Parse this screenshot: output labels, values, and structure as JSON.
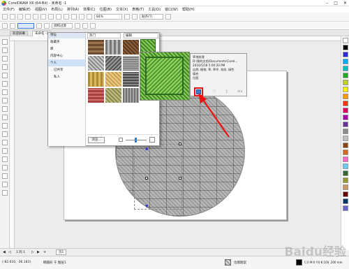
{
  "window": {
    "title": "CorelDRAW X6 (64-Bit) - 未命名 -1"
  },
  "menu": {
    "items": [
      "文件(F)",
      "编辑(E)",
      "视图(V)",
      "布局(L)",
      "排列(A)",
      "效果(C)",
      "位图(B)",
      "文本(X)",
      "表格(T)",
      "工具(O)",
      "窗口(W)",
      "帮助(H)"
    ]
  },
  "toolbar": {
    "zoom": "84%",
    "snap_label": "贴齐(T)",
    "snap2_label": "调和过渡"
  },
  "tabs": [
    "欢迎屏幕",
    "未命名 -1"
  ],
  "popup": {
    "folder_header": "预设",
    "folders": [
      "收藏夹",
      "库",
      "内容中心",
      "个人",
      "已共享",
      "私人"
    ],
    "selected_folder": "个人",
    "combo_category": "热门",
    "combo_filter": "编辑",
    "browse_label": "浏览..."
  },
  "preview_info": {
    "name": "草地纹理",
    "path": "D:\\我的文档\\Documents\\Corel...",
    "date": "2016/5/18 5:00:20 PM",
    "tags": "自然, 植物, 草, 草坪, 花纹, 绿色",
    "type1": "填充",
    "type2": "位图",
    "extra": "dra"
  },
  "pagebar": {
    "page_counter": "1 的 1",
    "page_tab": "页1"
  },
  "status": {
    "coords": "(-82.610, -36.183)",
    "layer": "椭圆形 于 图层1",
    "fill_label": "位图图案",
    "outline": "C:0 M:0 Y:0 K:100 .200 mm"
  },
  "watermark": "Baidu经验",
  "colors": {
    "accent": "#3a7bd5",
    "highlight_red": "#ee1111",
    "grass": "#5aa83a"
  },
  "palette": [
    "#ffffff",
    "#000000",
    "#2b2bd6",
    "#00aaff",
    "#00c0c0",
    "#22aa22",
    "#c0d020",
    "#ffee00",
    "#ff9900",
    "#ff3300",
    "#dd0066",
    "#aa00aa",
    "#663399",
    "#8c8c8c",
    "#c0c0c0",
    "#8b4513",
    "#d2691e",
    "#ff66cc",
    "#66ccff",
    "#336633",
    "#999933",
    "#cc9966",
    "#660000",
    "#003366",
    "#6666cc"
  ]
}
